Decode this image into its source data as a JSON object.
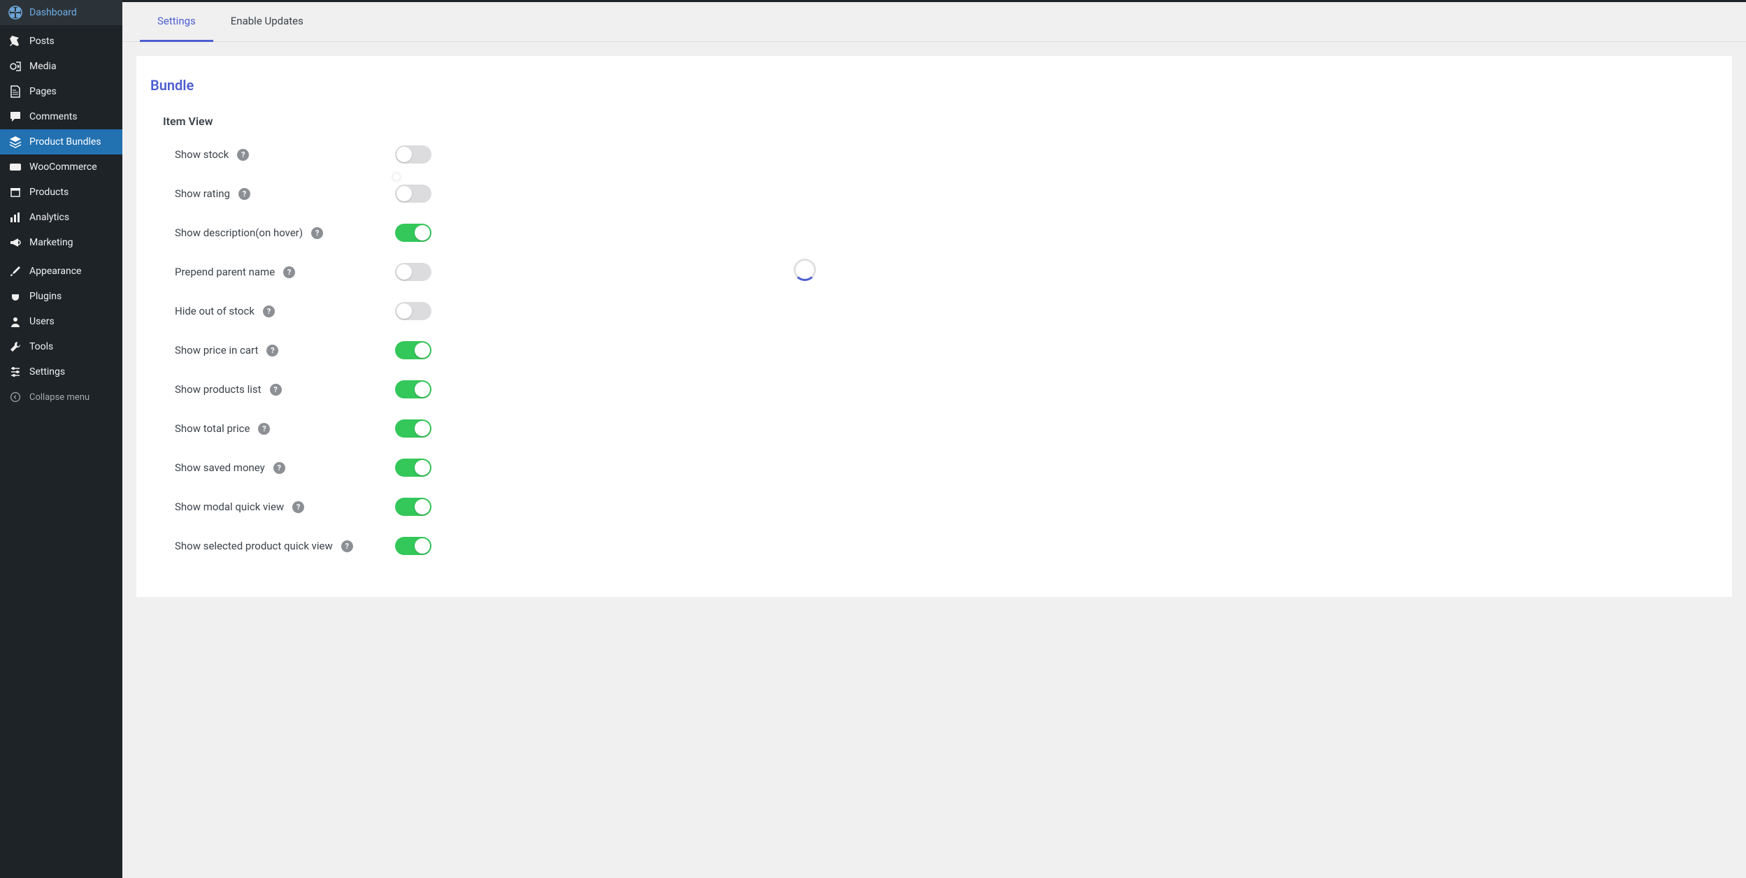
{
  "sidebar": {
    "items": [
      {
        "label": "Dashboard",
        "icon": "dashboard"
      },
      {
        "label": "Posts",
        "icon": "pin"
      },
      {
        "label": "Media",
        "icon": "media"
      },
      {
        "label": "Pages",
        "icon": "page"
      },
      {
        "label": "Comments",
        "icon": "comment"
      },
      {
        "label": "Product Bundles",
        "icon": "layers",
        "active": true
      },
      {
        "label": "WooCommerce",
        "icon": "woo"
      },
      {
        "label": "Products",
        "icon": "archive"
      },
      {
        "label": "Analytics",
        "icon": "chart"
      },
      {
        "label": "Marketing",
        "icon": "megaphone"
      },
      {
        "label": "Appearance",
        "icon": "brush"
      },
      {
        "label": "Plugins",
        "icon": "plug"
      },
      {
        "label": "Users",
        "icon": "user"
      },
      {
        "label": "Tools",
        "icon": "wrench"
      },
      {
        "label": "Settings",
        "icon": "sliders"
      }
    ],
    "collapse_label": "Collapse menu"
  },
  "tabs": [
    "Settings",
    "Enable Updates"
  ],
  "section_title": "Bundle",
  "subsection_title": "Item View",
  "settings": [
    {
      "label": "Show stock",
      "on": false
    },
    {
      "label": "Show rating",
      "on": false
    },
    {
      "label": "Show description(on hover)",
      "on": true
    },
    {
      "label": "Prepend parent name",
      "on": false
    },
    {
      "label": "Hide out of stock",
      "on": false
    },
    {
      "label": "Show price in cart",
      "on": true
    },
    {
      "label": "Show products list",
      "on": true
    },
    {
      "label": "Show total price",
      "on": true
    },
    {
      "label": "Show saved money",
      "on": true
    },
    {
      "label": "Show modal quick view",
      "on": true
    },
    {
      "label": "Show selected product quick view",
      "on": true
    }
  ]
}
